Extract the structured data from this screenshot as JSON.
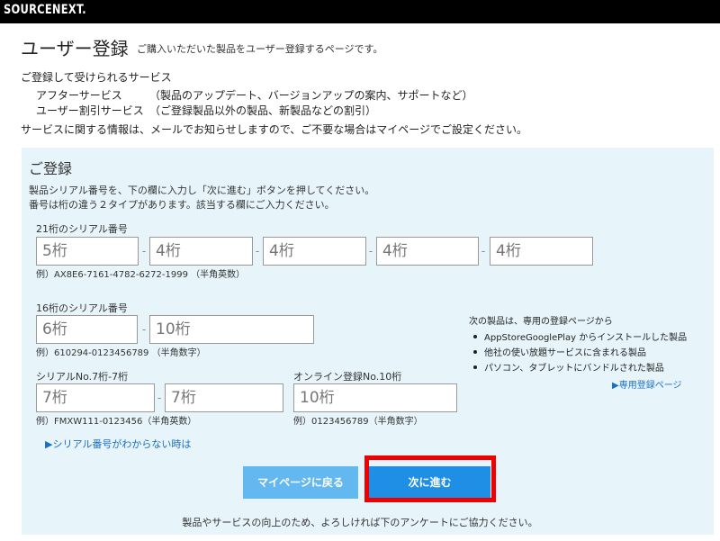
{
  "brand": {
    "logo": "SOURCENEXT."
  },
  "page": {
    "title": "ユーザー登録",
    "subtitle": "ご購入いただいた製品をユーザー登録するページです。"
  },
  "services": {
    "heading": "ご登録して受けられるサービス",
    "items": [
      {
        "name": "アフターサービス",
        "desc": "（製品のアップデート、バージョンアップの案内、サポートなど）"
      },
      {
        "name": "ユーザー割引サービス",
        "desc": "（ご登録製品以外の製品、新製品などの割引）"
      }
    ],
    "notice": "サービスに関する情報は、メールでお知らせしますので、ご不要な場合はマイページでご設定ください。"
  },
  "registration": {
    "title": "ご登録",
    "instruction1": "製品シリアル番号を、下の欄に入力し「次に進む」ボタンを押してください。",
    "instruction2": "番号は桁の違う２タイプがあります。該当する欄にご入力ください。",
    "serial21": {
      "label": "21桁のシリアル番号",
      "placeholders": [
        "5桁",
        "4桁",
        "4桁",
        "4桁",
        "4桁"
      ],
      "example": "例）AX8E6-7161-4782-6272-1999 （半角英数）"
    },
    "serial16": {
      "label": "16桁のシリアル番号",
      "placeholders": [
        "6桁",
        "10桁"
      ],
      "example": "例）610294-0123456789 （半角数字）"
    },
    "serial77": {
      "label": "シリアルNo.7桁-7桁",
      "placeholders": [
        "7桁",
        "7桁"
      ],
      "example": "例）FMXW111-0123456（半角英数）"
    },
    "online10": {
      "label": "オンライン登録No.10桁",
      "placeholder": "10桁",
      "example": "例）0123456789（半角数字）"
    },
    "dash": "-",
    "side_note": {
      "heading": "次の製品は、専用の登録ページから",
      "bullets": [
        "AppStoreGooglePlay からインストールした製品",
        "他社の使い放題サービスに含まれる製品",
        "パソコン、タブレットにバンドルされた製品"
      ],
      "link": "▶専用登録ページ"
    },
    "unknown_serial_link": "▶シリアル番号がわからない時は",
    "buttons": {
      "back": "マイページに戻る",
      "next": "次に進む"
    },
    "footer": "製品やサービスの向上のため、よろしければ下のアンケートにご協力ください。"
  },
  "colors": {
    "topbar": "#000000",
    "panel": "#e7f5fb",
    "back_button": "#62b8ef",
    "next_button": "#1f8fe5",
    "highlight": "#ee0000",
    "link": "#1a6fc1"
  }
}
